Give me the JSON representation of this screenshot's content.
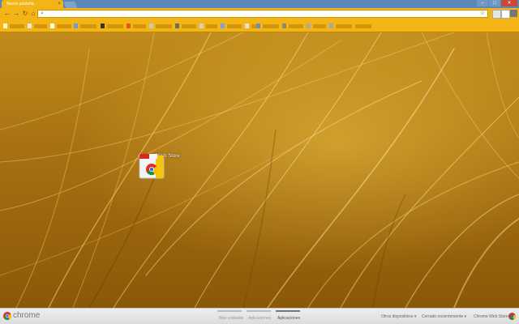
{
  "tab": {
    "title": "Nuevo pestaña",
    "close_icon": "×"
  },
  "window_controls": [
    "–",
    "□",
    "✕"
  ],
  "toolbar": {
    "back": "←",
    "forward": "→",
    "reload": "↻",
    "home": "⌂",
    "star": "☆"
  },
  "apps": [
    {
      "label": "Chrome Web Store",
      "icon": "chrome-web-store-icon"
    }
  ],
  "footer": {
    "brand": "chrome",
    "nav": [
      "Más visitadas",
      "Aplicaciones",
      "Aplicaciones"
    ],
    "active_index": 2,
    "links": [
      "Otros dispositivos",
      "Cerrado recientemente",
      "Chrome Web Store"
    ]
  },
  "colors": {
    "accent": "#f3b515",
    "frame": "#5b88b8",
    "wallpaper": "#b07a12"
  }
}
